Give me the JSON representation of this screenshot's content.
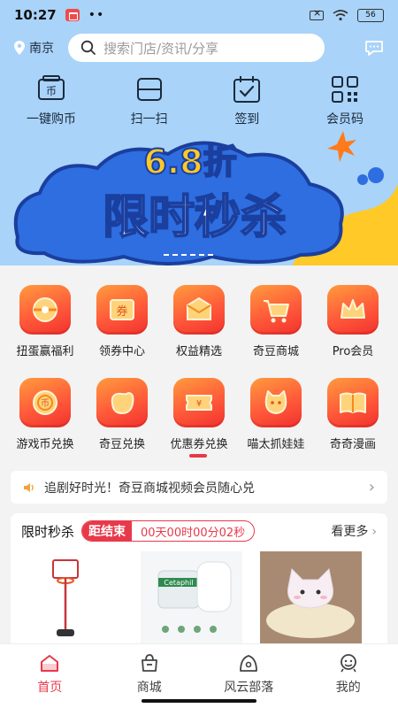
{
  "status_bar": {
    "time": "10:27",
    "dots": "••",
    "battery": "56"
  },
  "header": {
    "location": "南京",
    "search_placeholder": "搜索门店/资讯/分享"
  },
  "quick_actions": [
    {
      "label": "一键购币",
      "icon": "coin-card-icon"
    },
    {
      "label": "扫一扫",
      "icon": "scan-icon"
    },
    {
      "label": "签到",
      "icon": "calendar-check-icon"
    },
    {
      "label": "会员码",
      "icon": "qr-code-icon"
    }
  ],
  "banner": {
    "discount": "6.8折",
    "headline": "限时秒杀"
  },
  "feature_grid": [
    {
      "label": "扭蛋赢福利",
      "icon": "gashapon-icon"
    },
    {
      "label": "领券中心",
      "icon": "coupon-icon"
    },
    {
      "label": "权益精选",
      "icon": "gift-box-icon"
    },
    {
      "label": "奇豆商城",
      "icon": "cart-icon"
    },
    {
      "label": "Pro会员",
      "icon": "crown-icon"
    },
    {
      "label": "游戏币兑换",
      "icon": "game-coin-icon"
    },
    {
      "label": "奇豆兑换",
      "icon": "bean-icon"
    },
    {
      "label": "优惠券兑换",
      "icon": "ticket-icon"
    },
    {
      "label": "喵太抓娃娃",
      "icon": "cat-doll-icon"
    },
    {
      "label": "奇奇漫画",
      "icon": "comic-book-icon"
    }
  ],
  "notice": {
    "text": "追剧好时光！奇豆商城视频会员随心兑"
  },
  "flash_sale": {
    "title": "限时秒杀",
    "countdown_label": "距结束",
    "countdown_value": "00天00时00分02秒",
    "more_label": "看更多",
    "product_label": "Cetaphil"
  },
  "bottom_nav": [
    {
      "label": "首页",
      "active": true
    },
    {
      "label": "商城",
      "active": false
    },
    {
      "label": "风云部落",
      "active": false
    },
    {
      "label": "我的",
      "active": false
    }
  ],
  "colors": {
    "accent": "#e8394a",
    "header_bg": "#a9d3f8",
    "banner_blue": "#2e6ee0",
    "banner_yellow": "#ffc928"
  }
}
